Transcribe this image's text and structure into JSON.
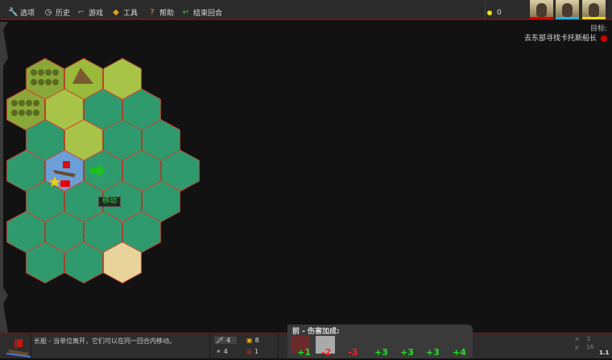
{
  "menu": [
    {
      "label": "选项",
      "icon": "wrench-icon",
      "glyph": "🔧"
    },
    {
      "label": "历史",
      "icon": "clock-icon",
      "glyph": "◷"
    },
    {
      "label": "游戏",
      "icon": "gun-icon",
      "glyph": "⌐"
    },
    {
      "label": "工具",
      "icon": "tools-icon",
      "glyph": "◆"
    },
    {
      "label": "帮助",
      "icon": "help-icon",
      "glyph": "?"
    },
    {
      "label": "结束回合",
      "icon": "end-turn-icon",
      "glyph": "↵"
    }
  ],
  "gold": "0",
  "portraits": [
    {
      "color": "#e00000"
    },
    {
      "color": "#22b4e6"
    },
    {
      "color": "#f0e000"
    }
  ],
  "objectives": {
    "title": "目标:",
    "items": [
      "去东部寻找卡托斯船长"
    ]
  },
  "map": {
    "move_label": "移动",
    "terrain_rows": [
      {
        "row": -3,
        "cells": [
          "forest",
          "mountain",
          "grass"
        ]
      },
      {
        "row": -2,
        "cells": [
          "forest",
          "grass",
          "water",
          "water"
        ]
      },
      {
        "row": -1,
        "cells": [
          "water",
          "grass",
          "water",
          "water"
        ]
      },
      {
        "row": 0,
        "cells": [
          "water",
          "shallow",
          "water",
          "water",
          "water"
        ]
      },
      {
        "row": 1,
        "cells": [
          "water",
          "water",
          "water",
          "water"
        ]
      },
      {
        "row": 2,
        "cells": [
          "water",
          "water",
          "water",
          "water"
        ]
      },
      {
        "row": 3,
        "cells": [
          "water",
          "water",
          "sand"
        ]
      }
    ],
    "colors": {
      "forest": "#8aa83a",
      "mountain": "#9aba3a",
      "grass": "#a8c448",
      "water": "#2f9a6e",
      "shallow": "#6c9ed8",
      "sand": "#e8d49a"
    }
  },
  "unit": {
    "description": "长船 - 当单位离开，它们可以在同一回合内移动。",
    "attack": "4",
    "defense": "8",
    "movement": "4",
    "range": "1"
  },
  "damage": {
    "title": "前 - 伤害加成:",
    "bonuses": [
      "+1",
      "-2",
      "-3",
      "+3",
      "+3",
      "+3",
      "+4"
    ]
  },
  "coords": {
    "x_label": "x:",
    "x": "2",
    "y_label": "y:",
    "y": "16"
  },
  "version": "1.1"
}
